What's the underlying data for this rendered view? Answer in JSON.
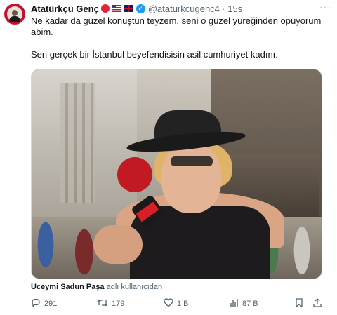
{
  "author": {
    "name": "Atatürkçü Genç",
    "handle": "@ataturkcugenc4",
    "separator": "·",
    "time": "15s",
    "badges": [
      "red-circle-emoji",
      "us-flag-emoji",
      "uk-flag-emoji"
    ]
  },
  "tweet": {
    "line1": "Ne kadar da güzel konuştun teyzem, seni o güzel yüreğinden öpüyorum abim.",
    "line2": "Sen gerçek bir İstanbul beyefendisisin asil cumhuriyet kadını."
  },
  "media": {
    "mic_logo_icon": "tv-channel-microphone-logo"
  },
  "source": {
    "user": "Uceymi Sadun Paşa",
    "suffix": "adlı kullanıcıdan"
  },
  "actions": {
    "replies": "291",
    "retweets": "179",
    "likes": "1 B",
    "views": "87 B"
  },
  "colors": {
    "verified": "#1d9bf0",
    "muted": "#536471",
    "text": "#0f1419"
  }
}
